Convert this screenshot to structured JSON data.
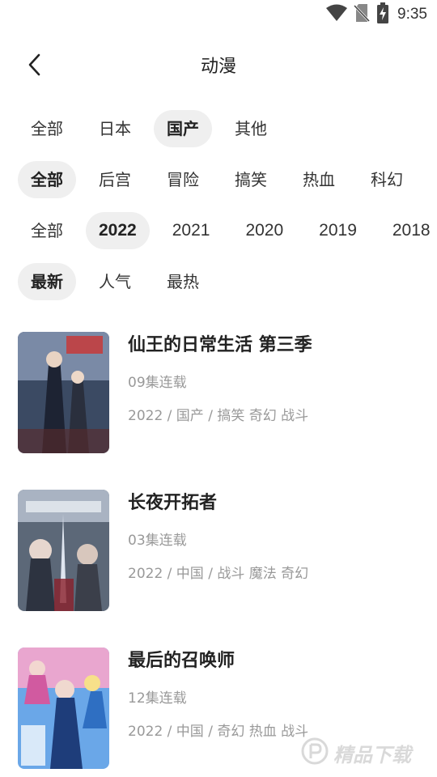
{
  "status_bar": {
    "time": "9:35"
  },
  "header": {
    "title": "动漫"
  },
  "filters": {
    "region": [
      {
        "label": "全部",
        "selected": false
      },
      {
        "label": "日本",
        "selected": false
      },
      {
        "label": "国产",
        "selected": true
      },
      {
        "label": "其他",
        "selected": false
      }
    ],
    "genre": [
      {
        "label": "全部",
        "selected": true
      },
      {
        "label": "后宫",
        "selected": false
      },
      {
        "label": "冒险",
        "selected": false
      },
      {
        "label": "搞笑",
        "selected": false
      },
      {
        "label": "热血",
        "selected": false
      },
      {
        "label": "科幻",
        "selected": false
      }
    ],
    "year": [
      {
        "label": "全部",
        "selected": false
      },
      {
        "label": "2022",
        "selected": true
      },
      {
        "label": "2021",
        "selected": false
      },
      {
        "label": "2020",
        "selected": false
      },
      {
        "label": "2019",
        "selected": false
      },
      {
        "label": "2018",
        "selected": false
      }
    ],
    "sort": [
      {
        "label": "最新",
        "selected": true
      },
      {
        "label": "人气",
        "selected": false
      },
      {
        "label": "最热",
        "selected": false
      }
    ]
  },
  "items": [
    {
      "title": "仙王的日常生活 第三季",
      "episodes": "09集连载",
      "tags": "2022 / 国产 / 搞笑 奇幻 战斗",
      "cover_color": "#3b4a63"
    },
    {
      "title": "长夜开拓者",
      "episodes": "03集连载",
      "tags": "2022 / 中国 / 战斗 魔法 奇幻",
      "cover_color": "#4a5566"
    },
    {
      "title": "最后的召唤师",
      "episodes": "12集连载",
      "tags": "2022 / 中国 / 奇幻 热血 战斗",
      "cover_color": "#4d78c9"
    }
  ],
  "watermark": {
    "text": "精品下载"
  },
  "icons": {
    "wifi": "wifi-icon",
    "no_sim": "no-sim-icon",
    "battery": "battery-charging-icon",
    "back": "back-arrow-icon"
  }
}
